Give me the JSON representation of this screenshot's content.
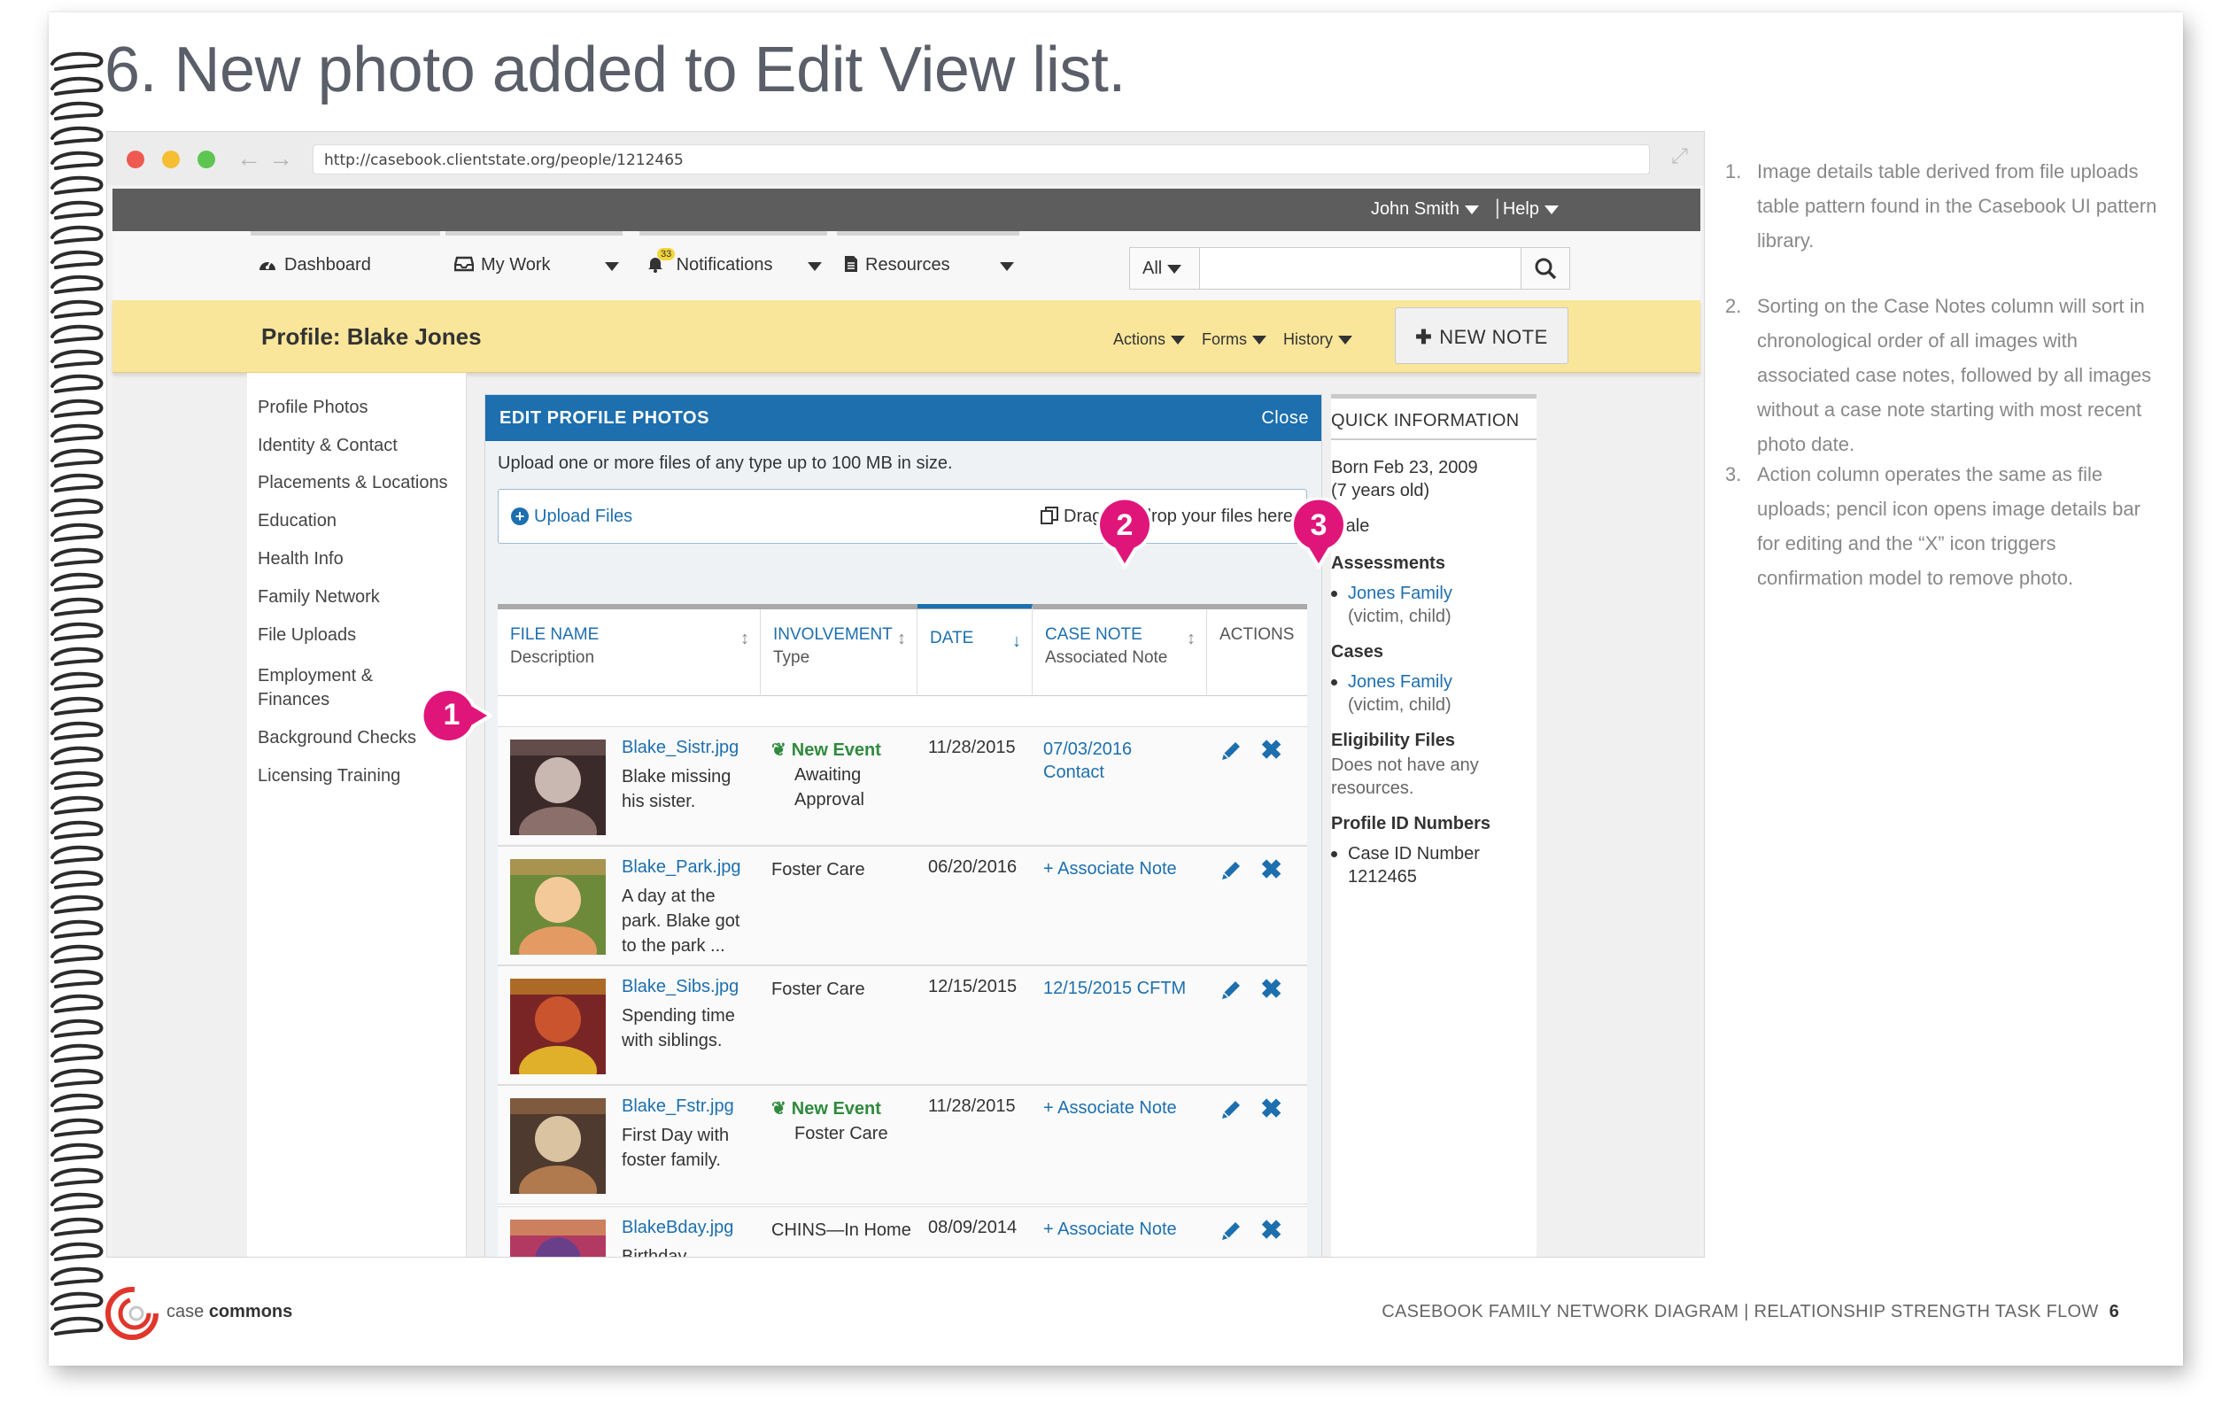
{
  "slide": {
    "title": "6. New photo added to Edit View list.",
    "notes": [
      {
        "num": "1.",
        "text": "Image details table derived from file uploads table pattern found in the Casebook UI pattern library."
      },
      {
        "num": "2.",
        "text": "Sorting on the Case Notes column will sort in chronological order of all images with associated case notes, followed by all images without a case note starting with most recent photo date."
      },
      {
        "num": "3.",
        "text": "Action column operates the same as file uploads; pencil icon opens image details bar for editing and the “X” icon triggers confirmation model to remove photo."
      }
    ],
    "markers": [
      "1",
      "2",
      "3"
    ],
    "footer": {
      "brand_light": "case",
      "brand_bold": "commons",
      "right_text": "CASEBOOK FAMILY NETWORK DIAGRAM | RELATIONSHIP STRENGTH TASK FLOW",
      "page_number": "6"
    }
  },
  "browser": {
    "url": "http://casebook.clientstate.org/people/1212465",
    "dot_colors": [
      "#ee5a52",
      "#f5be33",
      "#5ec553"
    ]
  },
  "app": {
    "topbar": {
      "user": "John Smith",
      "help": "Help",
      "separator": "|"
    },
    "nav": {
      "dashboard": "Dashboard",
      "my_work": "My Work",
      "notifications": "Notifications",
      "notifications_count": "33",
      "resources": "Resources"
    },
    "search": {
      "scope": "All",
      "placeholder": ""
    },
    "profile": {
      "title": "Profile: Blake Jones",
      "actions": "Actions",
      "forms": "Forms",
      "history": "History",
      "new_note": "NEW NOTE"
    },
    "sidebar": {
      "items": [
        "Profile Photos",
        "Identity & Contact",
        "Placements & Locations",
        "Education",
        "Health Info",
        "Family Network",
        "File Uploads",
        "Employment &",
        "Finances",
        "Background Checks",
        "Licensing Training"
      ]
    },
    "panel": {
      "title": "EDIT PROFILE PHOTOS",
      "close": "Close",
      "help": "Upload one or more files of any type up to 100 MB in size.",
      "upload": "Upload Files",
      "drop_text": "Drag and drop your files here",
      "columns": [
        {
          "title": "FILE NAME",
          "sub": "Description"
        },
        {
          "title": "INVOLVEMENT",
          "sub": "Type"
        },
        {
          "title": "DATE",
          "sub": ""
        },
        {
          "title": "CASE NOTE",
          "sub": "Associated Note"
        },
        {
          "title": "ACTIONS",
          "sub": ""
        }
      ],
      "rows": [
        {
          "file": "Blake_Sistr.jpg",
          "desc": "Blake missing his sister.",
          "event": "New Event",
          "type": "Awaiting Approval",
          "date": "11/28/2015",
          "note": "07/03/2016",
          "note2": "Contact"
        },
        {
          "file": "Blake_Park.jpg",
          "desc": "A day at the park. Blake got to the park ...",
          "event": "",
          "type": "Foster Care",
          "date": "06/20/2016",
          "note": "+ Associate Note",
          "note2": ""
        },
        {
          "file": "Blake_Sibs.jpg",
          "desc": "Spending time with siblings.",
          "event": "",
          "type": "Foster Care",
          "date": "12/15/2015",
          "note": "12/15/2015 CFTM",
          "note2": ""
        },
        {
          "file": "Blake_Fstr.jpg",
          "desc": "First Day with foster family.",
          "event": "New Event",
          "type": "Foster Care",
          "date": "11/28/2015",
          "note": "+ Associate Note",
          "note2": ""
        },
        {
          "file": "BlakeBday.jpg",
          "desc": "Birthday Celebration.",
          "event": "",
          "type": "CHINS—In Home",
          "date": "08/09/2014",
          "note": "+ Associate Note",
          "note2": ""
        }
      ]
    },
    "quick": {
      "title": "QUICK INFORMATION",
      "born": "Born Feb 23, 2009",
      "age": "(7 years old)",
      "gender": "Male",
      "assessments_label": "Assessments",
      "assessment_link": "Jones Family",
      "assessment_role": "(victim, child)",
      "cases_label": "Cases",
      "case_link": "Jones Family",
      "case_role": "(victim, child)",
      "eligibility_label": "Eligibility Files",
      "eligibility_text": "Does not have any resources.",
      "profile_ids_label": "Profile ID Numbers",
      "case_id_label": "Case ID Number",
      "case_id_value": "1212465"
    }
  }
}
